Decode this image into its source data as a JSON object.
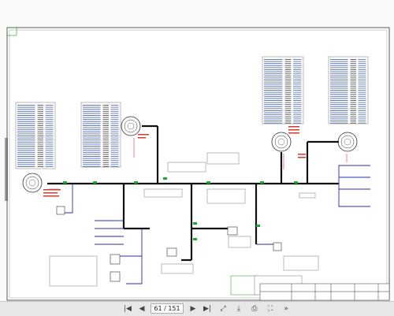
{
  "toolbar": {
    "first_icon": "first-page-icon",
    "prev_icon": "previous-page-icon",
    "page_current": "61",
    "page_sep": "/",
    "page_total": "151",
    "page_display": "61 / 151",
    "next_icon": "next-page-icon",
    "last_icon": "last-page-icon",
    "fit_icon": "fit-width-icon",
    "download_icon": "download-icon",
    "print_icon": "print-icon",
    "fullscreen_icon": "fullscreen-icon",
    "more_icon": "more-icon"
  },
  "colors": {
    "wire": "#111111",
    "blue_wire": "#2a2ab8",
    "pink_wire": "#d12a8a",
    "red_label": "#d23b2b",
    "green_tag": "#1fa83a",
    "table_text": "#2d4d9d",
    "frame": "#333333",
    "toolbar_bg": "#e7e7e7"
  }
}
